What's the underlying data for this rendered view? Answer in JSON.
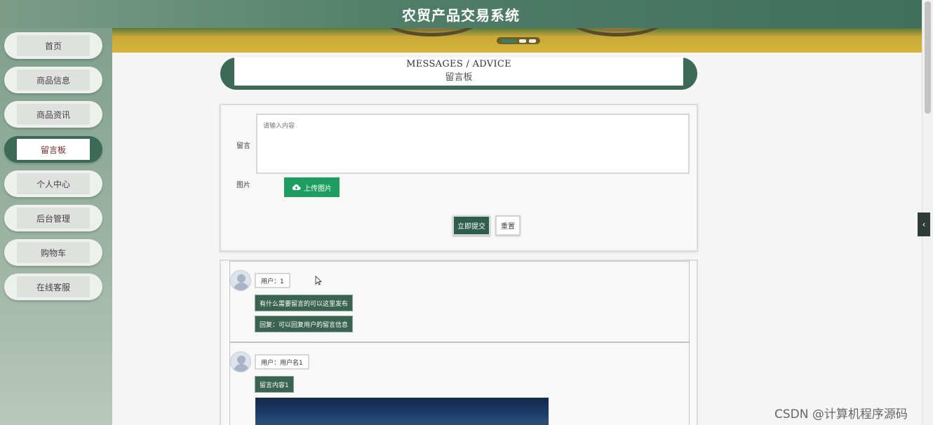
{
  "header": {
    "title": "农贸产品交易系统"
  },
  "sidebar": {
    "items": [
      {
        "label": "首页",
        "active": false
      },
      {
        "label": "商品信息",
        "active": false
      },
      {
        "label": "商品资讯",
        "active": false
      },
      {
        "label": "留言板",
        "active": true
      },
      {
        "label": "个人中心",
        "active": false
      },
      {
        "label": "后台管理",
        "active": false
      },
      {
        "label": "购物车",
        "active": false
      },
      {
        "label": "在线客服",
        "active": false
      }
    ]
  },
  "page_title": {
    "en": "MESSAGES / ADVICE",
    "cn": "留言板"
  },
  "form": {
    "message_label": "留言",
    "message_placeholder": "请输入内容",
    "image_label": "图片",
    "upload_label": "上传图片",
    "submit_label": "立即提交",
    "reset_label": "重置"
  },
  "messages": [
    {
      "user": "用户：1",
      "content": "有什么需要留言的可以这里发布",
      "reply": "回复：可以回复用户的留言信息"
    },
    {
      "user": "用户：用户名1",
      "content": "留言内容1"
    }
  ],
  "watermark": "CSDN @计算机程序源码",
  "colors": {
    "accent": "#3d6a56",
    "upload": "#1e9e5e",
    "active_text": "#7a2a2a"
  }
}
